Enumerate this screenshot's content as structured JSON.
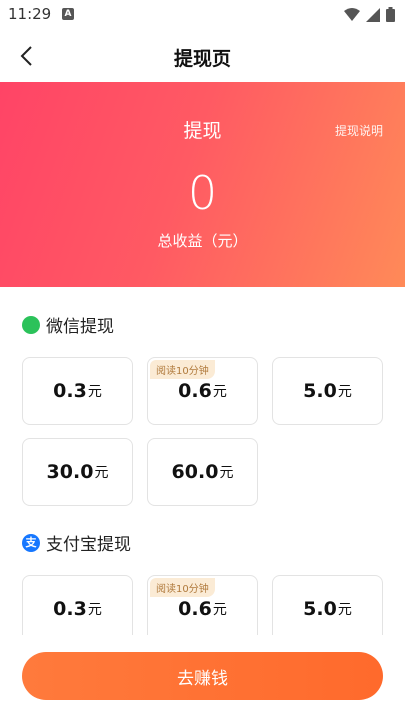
{
  "status_bar": {
    "time": "11:29",
    "notif_letter": "A"
  },
  "app_bar": {
    "title": "提现页"
  },
  "hero": {
    "title": "提现",
    "explain_link": "提现说明",
    "amount": "0",
    "subtitle": "总收益（元）"
  },
  "wechat": {
    "title": "微信提现",
    "options": [
      {
        "value": "0.3",
        "unit": "元",
        "tag": ""
      },
      {
        "value": "0.6",
        "unit": "元",
        "tag": "阅读10分钟"
      },
      {
        "value": "5.0",
        "unit": "元",
        "tag": ""
      },
      {
        "value": "30.0",
        "unit": "元",
        "tag": ""
      },
      {
        "value": "60.0",
        "unit": "元",
        "tag": ""
      }
    ]
  },
  "alipay": {
    "title": "支付宝提现",
    "icon_text": "支",
    "options": [
      {
        "value": "0.3",
        "unit": "元",
        "tag": ""
      },
      {
        "value": "0.6",
        "unit": "元",
        "tag": "阅读10分钟"
      },
      {
        "value": "5.0",
        "unit": "元",
        "tag": ""
      }
    ]
  },
  "bottom": {
    "button_label": "去赚钱"
  },
  "colors": {
    "hero_start": "#ff4466",
    "hero_end": "#ff8a58",
    "button": "#ff6a2c",
    "tag_bg": "#fbebd5",
    "tag_text": "#b07a3c"
  }
}
